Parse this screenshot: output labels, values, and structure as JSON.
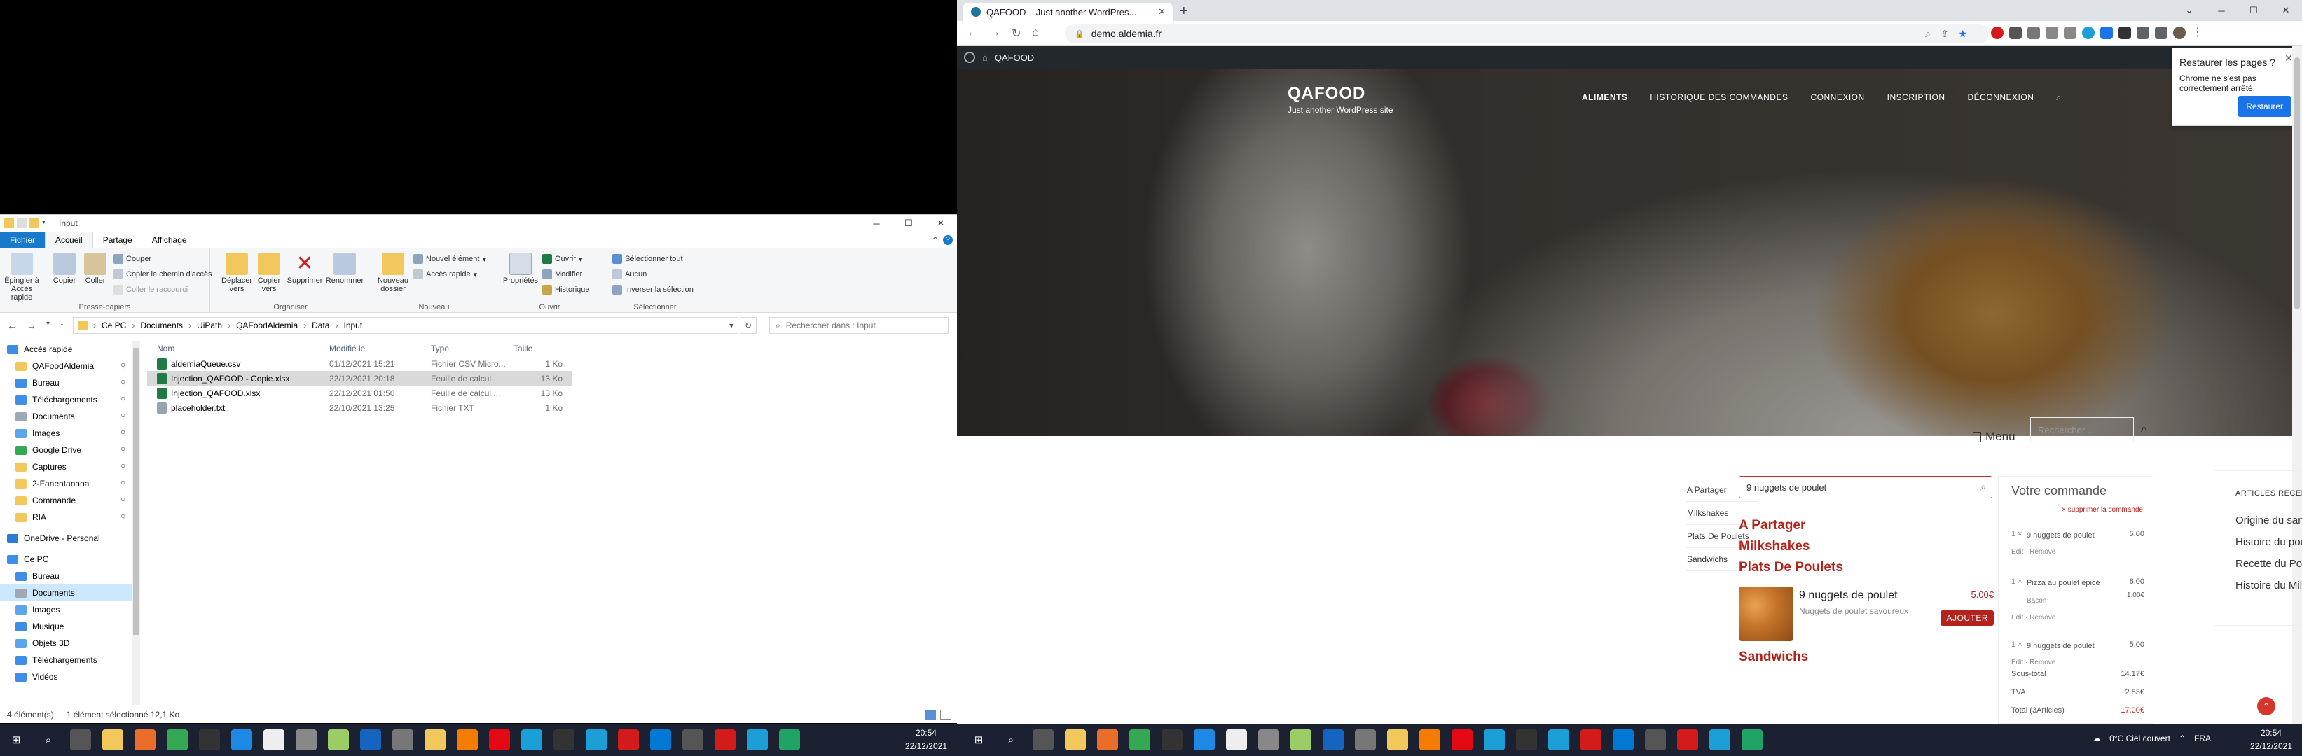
{
  "explorer": {
    "title": "Input",
    "tabs": [
      "Fichier",
      "Accueil",
      "Partage",
      "Affichage"
    ],
    "ribbon": {
      "pin": "Épingler à Accès rapide",
      "copy": "Copier",
      "paste": "Coller",
      "cut": "Couper",
      "copy_path": "Copier le chemin d'accès",
      "paste_shortcut": "Coller le raccourci",
      "group_clipboard": "Presse-papiers",
      "move_to": "Déplacer vers",
      "copy_to": "Copier vers",
      "delete": "Supprimer",
      "rename": "Renommer",
      "group_organize": "Organiser",
      "new_folder": "Nouveau dossier",
      "new_item": "Nouvel élément",
      "easy_access": "Accès rapide",
      "group_new": "Nouveau",
      "properties": "Propriétés",
      "open": "Ouvrir",
      "modify": "Modifier",
      "history": "Historique",
      "group_open": "Ouvrir",
      "select_all": "Sélectionner tout",
      "select_none": "Aucun",
      "invert": "Inverser la sélection",
      "group_select": "Sélectionner"
    },
    "path": [
      "Ce PC",
      "Documents",
      "UiPath",
      "QAFoodAldemia",
      "Data",
      "Input"
    ],
    "search_placeholder": "Rechercher dans : Input",
    "nav": [
      {
        "label": "Accès rapide",
        "root": true,
        "pin": false,
        "color": "#3f8de6"
      },
      {
        "label": "QAFoodAldemia",
        "root": false,
        "pin": true,
        "color": "#f2c75c"
      },
      {
        "label": "Bureau",
        "root": false,
        "pin": true,
        "color": "#3f8de6"
      },
      {
        "label": "Téléchargements",
        "root": false,
        "pin": true,
        "color": "#3f8de6"
      },
      {
        "label": "Documents",
        "root": false,
        "pin": true,
        "color": "#a0a8b4"
      },
      {
        "label": "Images",
        "root": false,
        "pin": true,
        "color": "#5ba5e8"
      },
      {
        "label": "Google Drive",
        "root": false,
        "pin": true,
        "color": "#34a853"
      },
      {
        "label": "Captures",
        "root": false,
        "pin": true,
        "color": "#f2c75c"
      },
      {
        "label": "2-Fanentanana",
        "root": false,
        "pin": true,
        "color": "#f2c75c"
      },
      {
        "label": "Commande",
        "root": false,
        "pin": true,
        "color": "#f2c75c"
      },
      {
        "label": "RIA",
        "root": false,
        "pin": true,
        "color": "#f2c75c"
      },
      {
        "label": "OneDrive - Personal",
        "root": true,
        "pin": false,
        "color": "#2a7ad8"
      },
      {
        "label": "Ce PC",
        "root": true,
        "pin": false,
        "color": "#3f8de6"
      },
      {
        "label": "Bureau",
        "root": false,
        "pin": false,
        "color": "#3f8de6"
      },
      {
        "label": "Documents",
        "root": false,
        "pin": false,
        "color": "#a0a8b4",
        "selected": true
      },
      {
        "label": "Images",
        "root": false,
        "pin": false,
        "color": "#5ba5e8"
      },
      {
        "label": "Musique",
        "root": false,
        "pin": false,
        "color": "#3f8de6"
      },
      {
        "label": "Objets 3D",
        "root": false,
        "pin": false,
        "color": "#5ba5e8"
      },
      {
        "label": "Téléchargements",
        "root": false,
        "pin": false,
        "color": "#3f8de6"
      },
      {
        "label": "Vidéos",
        "root": false,
        "pin": false,
        "color": "#3f8de6"
      }
    ],
    "columns": {
      "name": "Nom",
      "modified": "Modifié le",
      "type": "Type",
      "size": "Taille"
    },
    "files": [
      {
        "name": "aldemiaQueue.csv",
        "modified": "01/12/2021 15:21",
        "type": "Fichier CSV Micro...",
        "size": "1 Ko",
        "color": "#1f7a45",
        "selected": false
      },
      {
        "name": "Injection_QAFOOD - Copie.xlsx",
        "modified": "22/12/2021 20:18",
        "type": "Feuille de calcul ...",
        "size": "13 Ko",
        "color": "#1f7a45",
        "selected": true
      },
      {
        "name": "Injection_QAFOOD.xlsx",
        "modified": "22/12/2021 01:50",
        "type": "Feuille de calcul ...",
        "size": "13 Ko",
        "color": "#1f7a45",
        "selected": false
      },
      {
        "name": "placeholder.txt",
        "modified": "22/10/2021 13:25",
        "type": "Fichier TXT",
        "size": "1 Ko",
        "color": "#9aa4b1",
        "selected": false
      }
    ],
    "status": {
      "count": "4 élément(s)",
      "selection": "1 élément sélectionné  12,1 Ko"
    }
  },
  "taskbar_left": {
    "time": "20:54",
    "date": "22/12/2021"
  },
  "taskbar_right": {
    "weather": "0°C  Ciel couvert",
    "lang": "FRA",
    "time": "20:54",
    "date": "22/12/2021"
  },
  "chrome": {
    "tab_title": "QAFOOD – Just another WordPres...",
    "url": "demo.aldemia.fr",
    "wp_site": "QAFOOD",
    "site": {
      "title": "QAFOOD",
      "tagline": "Just another WordPress site"
    },
    "nav": [
      "ALIMENTS",
      "HISTORIQUE DES COMMANDES",
      "CONNEXION",
      "INSCRIPTION",
      "DÉCONNEXION"
    ],
    "restore": {
      "title": "Restaurer les pages ?",
      "message": "Chrome ne s'est pas correctement arrêté.",
      "button": "Restaurer"
    },
    "menu_label": "Menu",
    "widget_search_placeholder": "Rechercher ...",
    "categories_nav": [
      "A Partager",
      "Milkshakes",
      "Plats De Poulets",
      "Sandwichs"
    ],
    "menu_search_value": "9 nuggets de poulet",
    "categories": [
      "A Partager",
      "Milkshakes",
      "Plats De Poulets",
      "Sandwichs"
    ],
    "product": {
      "name": "9 nuggets de poulet",
      "desc": "Nuggets de poulet savoureux",
      "price": "5.00€",
      "button": "AJOUTER"
    },
    "cart": {
      "title": "Votre commande",
      "clear": "× supprimer la commande",
      "lines": [
        {
          "qty": "1 ×",
          "name": "9 nuggets de poulet",
          "price": "5.00",
          "option": "",
          "option_price": "",
          "actions": "Edit · Remove"
        },
        {
          "qty": "1 ×",
          "name": "Pizza au poulet épicé",
          "price": "6.00",
          "option": "Bacon",
          "option_price": "1.00€",
          "actions": "Edit · Remove"
        },
        {
          "qty": "1 ×",
          "name": "9 nuggets de poulet",
          "price": "5.00",
          "option": "",
          "option_price": "",
          "actions": "Edit · Remove"
        }
      ],
      "subtotal_label": "Sous-total",
      "subtotal": "14.17€",
      "tva_label": "TVA",
      "tva": "2.83€",
      "total_label": "Total (3Articles)",
      "total": "17.00€"
    },
    "recent": {
      "title": "ARTICLES RÉCENTS",
      "items": [
        "Origine du sandwich",
        "Histoire du poulet Tikka",
        "Recette du Poulet Kerala",
        "Histoire du Milk-shake"
      ]
    }
  }
}
